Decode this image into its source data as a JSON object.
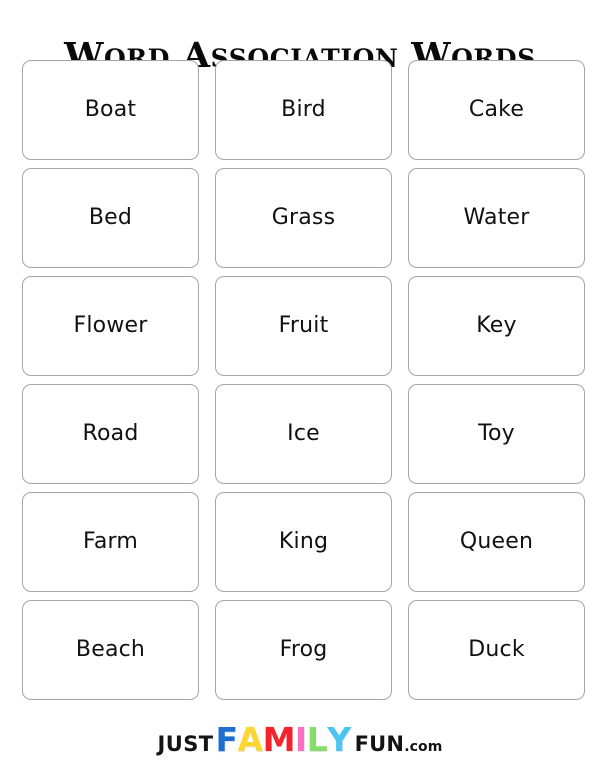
{
  "page": {
    "title": "Word Association Words",
    "background_color": "#ffffff"
  },
  "worksheet": {
    "card_border_color": "#a6a6a6",
    "card_text_color": "#111111",
    "columns": 3,
    "rows": 6,
    "total_cards": 18,
    "cards": [
      {
        "label": "Boat"
      },
      {
        "label": "Bird"
      },
      {
        "label": "Cake"
      },
      {
        "label": "Bed"
      },
      {
        "label": "Grass"
      },
      {
        "label": "Water"
      },
      {
        "label": "Flower"
      },
      {
        "label": "Fruit"
      },
      {
        "label": "Key"
      },
      {
        "label": "Road"
      },
      {
        "label": "Ice"
      },
      {
        "label": "Toy"
      },
      {
        "label": "Farm"
      },
      {
        "label": "King"
      },
      {
        "label": "Queen"
      },
      {
        "label": "Beach"
      },
      {
        "label": "Frog"
      },
      {
        "label": "Duck"
      }
    ]
  },
  "footer": {
    "logo": {
      "prefix": "JUST",
      "prefix_color": "#141414",
      "word_letters": [
        {
          "char": "F",
          "color": "#1f6fd0"
        },
        {
          "char": "A",
          "color": "#fcd733"
        },
        {
          "char": "M",
          "color": "#f4232c"
        },
        {
          "char": "I",
          "color": "#fb6fc0"
        },
        {
          "char": "L",
          "color": "#86dd6b"
        },
        {
          "char": "Y",
          "color": "#4bc5f2"
        }
      ],
      "suffix": "FUN",
      "suffix_color": "#141414",
      "tld": ".com",
      "tld_color": "#141414"
    }
  }
}
